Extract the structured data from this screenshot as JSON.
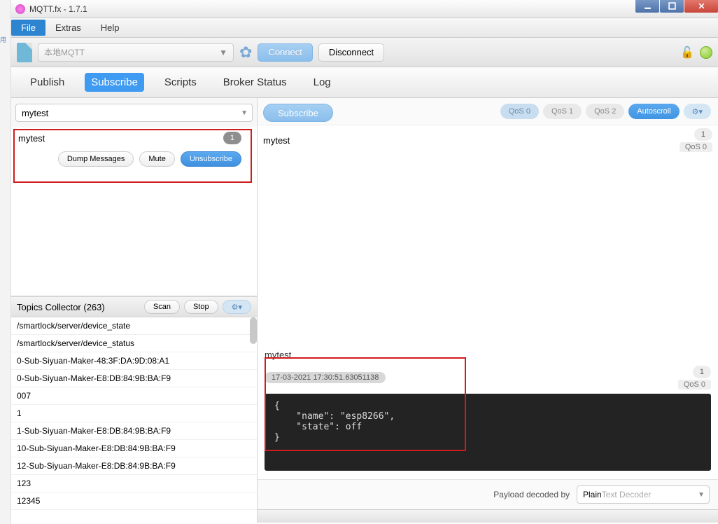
{
  "window": {
    "title": "MQTT.fx - 1.7.1"
  },
  "menu": {
    "file": "File",
    "extras": "Extras",
    "help": "Help"
  },
  "conn": {
    "profile": "本地MQTT",
    "connect": "Connect",
    "disconnect": "Disconnect"
  },
  "tabs": {
    "publish": "Publish",
    "subscribe": "Subscribe",
    "scripts": "Scripts",
    "broker": "Broker Status",
    "log": "Log"
  },
  "subscribe": {
    "topic": "mytest",
    "btn": "Subscribe",
    "item_topic": "mytest",
    "item_count": "1",
    "dump": "Dump Messages",
    "mute": "Mute",
    "unsub": "Unsubscribe"
  },
  "qos": {
    "q0": "QoS 0",
    "q1": "QoS 1",
    "q2": "QoS 2",
    "autoscroll": "Autoscroll",
    "gear_icon": "⚙▾"
  },
  "msg_head": {
    "topic": "mytest",
    "count": "1",
    "qos": "QoS 0"
  },
  "collector": {
    "title": "Topics Collector (263)",
    "scan": "Scan",
    "stop": "Stop",
    "gear_icon": "⚙▾",
    "items": [
      "/smartlock/server/device_state",
      "/smartlock/server/device_status",
      "0-Sub-Siyuan-Maker-48:3F:DA:9D:08:A1",
      "0-Sub-Siyuan-Maker-E8:DB:84:9B:BA:F9",
      "007",
      "1",
      "1-Sub-Siyuan-Maker-E8:DB:84:9B:BA:F9",
      "10-Sub-Siyuan-Maker-E8:DB:84:9B:BA:F9",
      "12-Sub-Siyuan-Maker-E8:DB:84:9B:BA:F9",
      "123",
      "12345"
    ]
  },
  "detail": {
    "topic": "mytest",
    "count": "1",
    "qos": "QoS 0",
    "timestamp": "17-03-2021  17:30:51.63051138",
    "payload": "{\n    \"name\": \"esp8266\",\n    \"state\": off\n}"
  },
  "footer": {
    "label": "Payload decoded by",
    "decoder_prefix": "Plain",
    "decoder_suffix": " Text Decoder"
  }
}
